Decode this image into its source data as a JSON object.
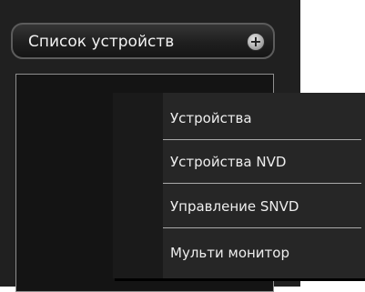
{
  "header": {
    "title": "Список устройств",
    "add_icon": "plus-circle-icon",
    "add_glyph": "+"
  },
  "context_menu": {
    "items": [
      {
        "label": "Устройства"
      },
      {
        "label": "Устройства NVD"
      },
      {
        "label": "Управление SNVD"
      },
      {
        "label": "Мульти монитор"
      }
    ]
  },
  "colors": {
    "panel_bg": "#202020",
    "menu_bg": "#262626",
    "text": "#eeeeee",
    "separator": "#aaaaaa"
  }
}
